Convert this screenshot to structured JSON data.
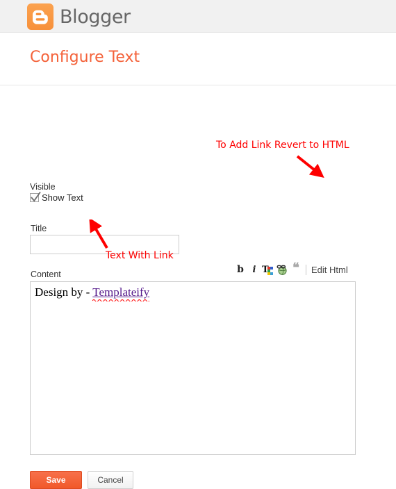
{
  "header": {
    "brand_label": "Blogger",
    "brand_icon": "blogger-logo-icon",
    "brand_color": "#f7903a"
  },
  "page": {
    "title": "Configure Text",
    "title_color": "#f4623a"
  },
  "form": {
    "visible_label": "Visible",
    "show_text": {
      "label": "Show Text",
      "checked": true
    },
    "title_field": {
      "label": "Title",
      "value": "",
      "placeholder": ""
    },
    "content_field": {
      "label": "Content",
      "text_prefix": "Design by - ",
      "link_text": "Templateify",
      "link_color": "#551a8b",
      "spellcheck_underline_color": "#fe0000"
    }
  },
  "toolbar": {
    "bold_label": "b",
    "italic_label": "i",
    "text_color_icon": "text-color-icon",
    "link_icon": "hyperlink-globe-icon",
    "quote_label": "❝",
    "edit_html_label": "Edit Html"
  },
  "buttons": {
    "save_label": "Save",
    "save_color": "#f15829",
    "cancel_label": "Cancel"
  },
  "annotations": {
    "html_note": "To Add Link Revert to HTML",
    "link_note": "Text With Link",
    "color": "#fe0000"
  }
}
